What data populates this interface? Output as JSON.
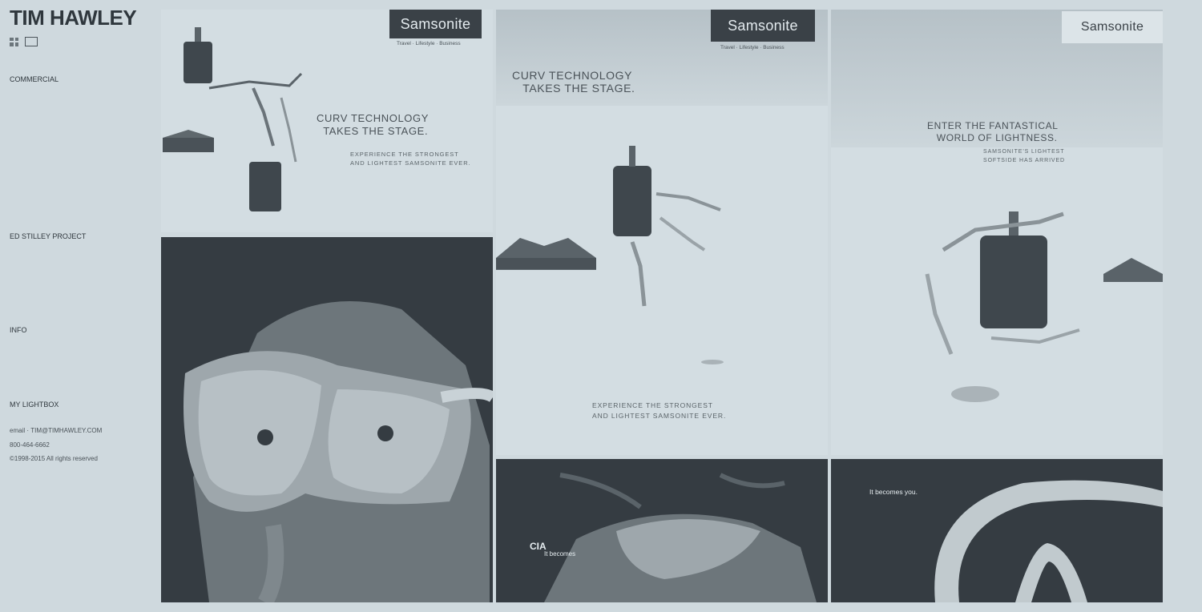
{
  "site": {
    "title": "TIM HAWLEY"
  },
  "nav": {
    "items": [
      {
        "label": "",
        "type": "faint"
      },
      {
        "label": "COMMERCIAL",
        "type": "head"
      },
      {
        "label": "",
        "type": "faint"
      },
      {
        "label": "",
        "type": "faint"
      },
      {
        "label": "",
        "type": "faint"
      },
      {
        "label": "",
        "type": "faint"
      },
      {
        "label": "",
        "type": "faint"
      },
      {
        "label": "",
        "type": "faint"
      },
      {
        "label": "",
        "type": "faint"
      },
      {
        "label": "",
        "type": "faint"
      },
      {
        "label": "",
        "type": "faint"
      },
      {
        "label": "ED STILLEY PROJECT",
        "type": "head"
      },
      {
        "label": "",
        "type": "faint"
      },
      {
        "label": "",
        "type": "faint"
      },
      {
        "label": "",
        "type": "faint"
      },
      {
        "label": "",
        "type": "faint"
      },
      {
        "label": "",
        "type": "faint"
      },
      {
        "label": "INFO",
        "type": "head"
      },
      {
        "label": "",
        "type": "faint"
      },
      {
        "label": "",
        "type": "faint"
      },
      {
        "label": "",
        "type": "faint"
      }
    ]
  },
  "lightbox": {
    "label": "MY LIGHTBOX"
  },
  "contact": {
    "email_prefix": "email",
    "email": "TIM@TIMHAWLEY.COM",
    "phone": "800-464-6662",
    "copyright": "©1998-2015 All rights reserved"
  },
  "tiles": {
    "ad1": {
      "brand": "Samsonite",
      "tagline": "Travel · Lifestyle · Business",
      "headline": "CURV TECHNOLOGY\n  TAKES THE STAGE.",
      "sub": "EXPERIENCE THE STRONGEST\nAND LIGHTEST SAMSONITE EVER."
    },
    "ad2": {
      "brand": "Samsonite",
      "tagline": "Travel · Lifestyle · Business",
      "headline": "CURV TECHNOLOGY\n   TAKES THE STAGE.",
      "sub": "EXPERIENCE THE STRONGEST\nAND LIGHTEST SAMSONITE EVER."
    },
    "ad3": {
      "brand": "Samsonite",
      "headline": "ENTER THE FANTASTICAL\n   WORLD OF LIGHTNESS.",
      "sub": "SAMSONITE'S LIGHTEST\nSOFTSIDE HAS ARRIVED"
    },
    "ad5": {
      "brand_text": "CIA",
      "tagline": "It becomes"
    },
    "ad6": {
      "tagline": "It becomes you."
    }
  },
  "colors": {
    "background": "#cfd9de",
    "dark": "#353c42",
    "brand_box": "#3a4147"
  }
}
